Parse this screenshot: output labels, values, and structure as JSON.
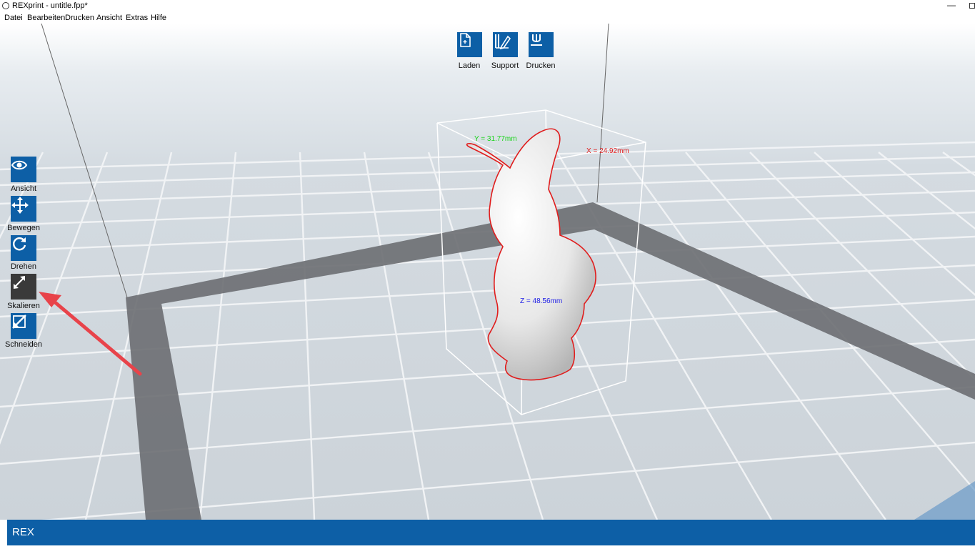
{
  "window": {
    "title": "REXprint - untitle.fpp*",
    "minimize_glyph": "—"
  },
  "menu": [
    "Datei",
    "Bearbeiten",
    "Drucken",
    "Ansicht",
    "Extras",
    "Hilfe"
  ],
  "top_toolbar": [
    {
      "label": "Laden",
      "icon": "file-icon"
    },
    {
      "label": "Support",
      "icon": "support-icon"
    },
    {
      "label": "Drucken",
      "icon": "print-icon"
    }
  ],
  "left_toolbar": [
    {
      "label": "Ansicht",
      "icon": "eye-icon",
      "active": false
    },
    {
      "label": "Bewegen",
      "icon": "move-icon",
      "active": false
    },
    {
      "label": "Drehen",
      "icon": "rotate-icon",
      "active": false
    },
    {
      "label": "Skalieren",
      "icon": "scale-icon",
      "active": true
    },
    {
      "label": "Schneiden",
      "icon": "cut-icon",
      "active": false
    }
  ],
  "model": {
    "dimensions": {
      "y": "Y = 31.77mm",
      "x": "X = 24.92mm",
      "z": "Z = 48.56mm"
    },
    "dimension_colors": {
      "x": "#e02020",
      "y": "#19d419",
      "z": "#1a1ae6"
    }
  },
  "status": {
    "text": "REX"
  },
  "colors": {
    "accent": "#0d5fa6",
    "active_tool": "#3a3a3a",
    "annotation_arrow": "#e8434a"
  }
}
